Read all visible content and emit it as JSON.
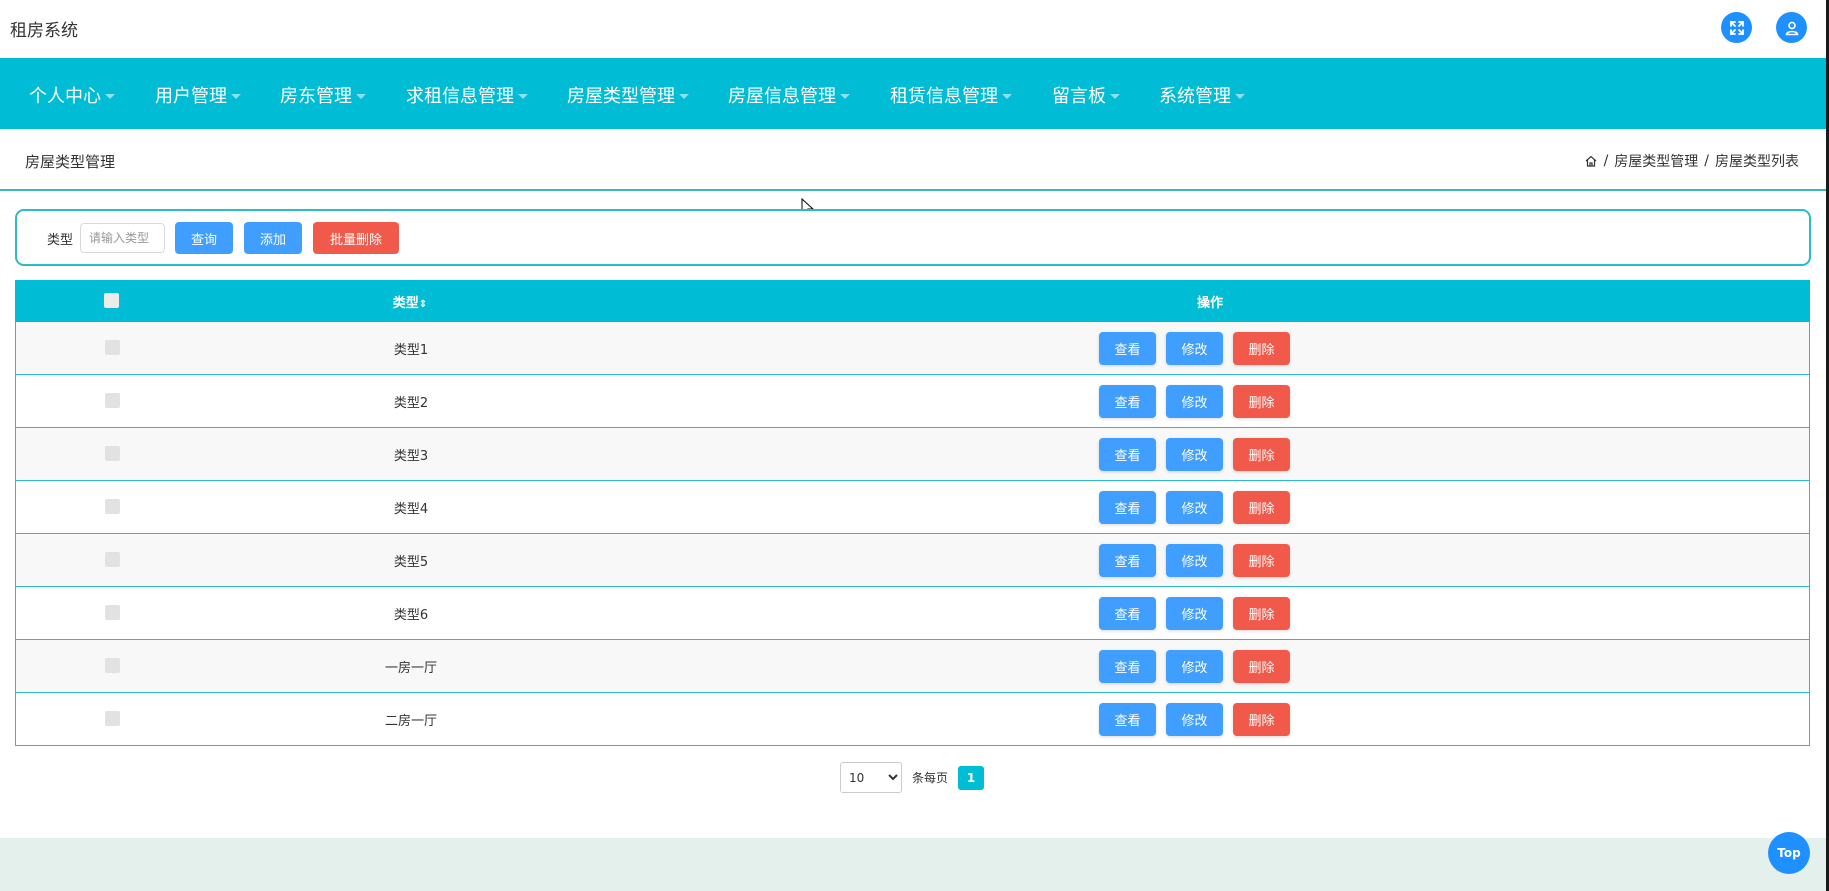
{
  "app": {
    "title": "租房系统"
  },
  "header_actions": [
    {
      "name": "fullscreen-icon"
    },
    {
      "name": "user-icon"
    }
  ],
  "nav": {
    "items": [
      {
        "label": "个人中心"
      },
      {
        "label": "用户管理"
      },
      {
        "label": "房东管理"
      },
      {
        "label": "求租信息管理"
      },
      {
        "label": "房屋类型管理"
      },
      {
        "label": "房屋信息管理"
      },
      {
        "label": "租赁信息管理"
      },
      {
        "label": "留言板"
      },
      {
        "label": "系统管理"
      }
    ]
  },
  "page": {
    "title": "房屋类型管理",
    "breadcrumb": [
      "房屋类型管理",
      "房屋类型列表"
    ]
  },
  "search": {
    "label": "类型",
    "placeholder": "请输入类型",
    "query_label": "查询",
    "add_label": "添加",
    "batch_delete_label": "批量删除"
  },
  "table": {
    "columns": {
      "type": "类型",
      "sort_glyph": "⇕",
      "actions": "操作"
    },
    "rows": [
      {
        "type": "类型1"
      },
      {
        "type": "类型2"
      },
      {
        "type": "类型3"
      },
      {
        "type": "类型4"
      },
      {
        "type": "类型5"
      },
      {
        "type": "类型6"
      },
      {
        "type": "一房一厅"
      },
      {
        "type": "二房一厅"
      }
    ],
    "row_actions": {
      "view": "查看",
      "edit": "修改",
      "delete": "删除"
    }
  },
  "pagination": {
    "page_size": "10",
    "page_size_options": [
      "10"
    ],
    "per_page_label": "条每页",
    "current_page": "1"
  },
  "back_to_top": {
    "label": "Top"
  },
  "colors": {
    "primary": "#00bcd4",
    "button_blue": "#409eff",
    "button_red": "#f15a4a",
    "icon_blue": "#1e90ff",
    "footer": "#e4f0ec"
  }
}
